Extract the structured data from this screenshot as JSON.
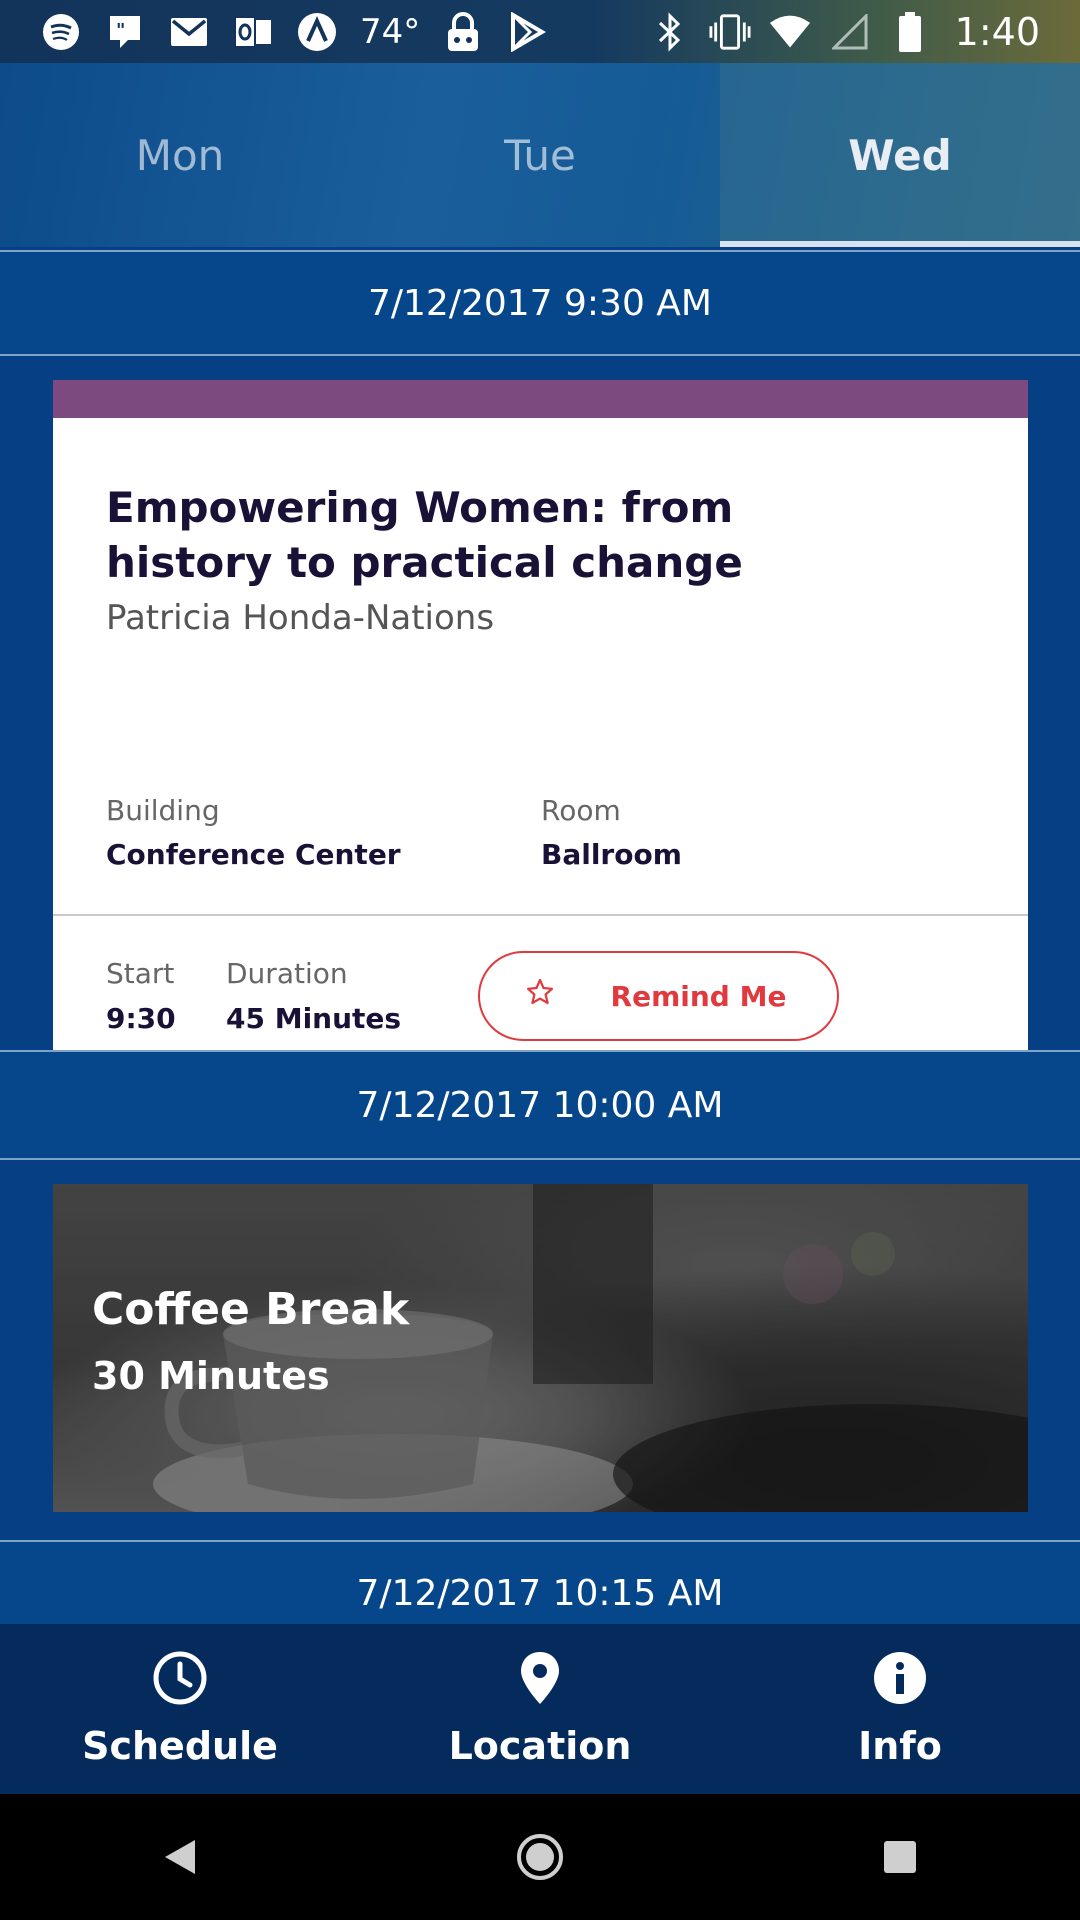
{
  "status_bar": {
    "temperature": "74°",
    "time": "1:40",
    "left_icons": [
      "spotify-icon",
      "quote-icon",
      "gmail-icon",
      "outlook-icon",
      "arc-icon",
      "temperature",
      "vpn-lock-icon",
      "play-store-icon"
    ],
    "right_icons": [
      "bluetooth-icon",
      "vibrate-icon",
      "wifi-icon",
      "signal-icon",
      "battery-icon"
    ]
  },
  "day_tabs": [
    {
      "label": "Mon",
      "active": false
    },
    {
      "label": "Tue",
      "active": false
    },
    {
      "label": "Wed",
      "active": true
    }
  ],
  "time_slots": [
    "7/12/2017 9:30 AM",
    "7/12/2017 10:00 AM",
    "7/12/2017 10:15 AM"
  ],
  "session": {
    "title": "Empowering Women: from history to practical change",
    "speaker": "Patricia Honda-Nations",
    "building_label": "Building",
    "building": "Conference Center",
    "room_label": "Room",
    "room": "Ballroom",
    "start_label": "Start",
    "start": "9:30",
    "duration_label": "Duration",
    "duration": "45 Minutes",
    "remind_label": "Remind Me",
    "stripe_color": "#7d4a7f",
    "accent_color": "#e0393e"
  },
  "break": {
    "title": "Coffee Break",
    "duration": "30 Minutes"
  },
  "bottom_nav": [
    {
      "label": "Schedule",
      "icon": "clock-icon"
    },
    {
      "label": "Location",
      "icon": "location-pin-icon"
    },
    {
      "label": "Info",
      "icon": "info-icon"
    }
  ],
  "colors": {
    "primary": "#063f84",
    "nav_background": "#052a5c"
  }
}
